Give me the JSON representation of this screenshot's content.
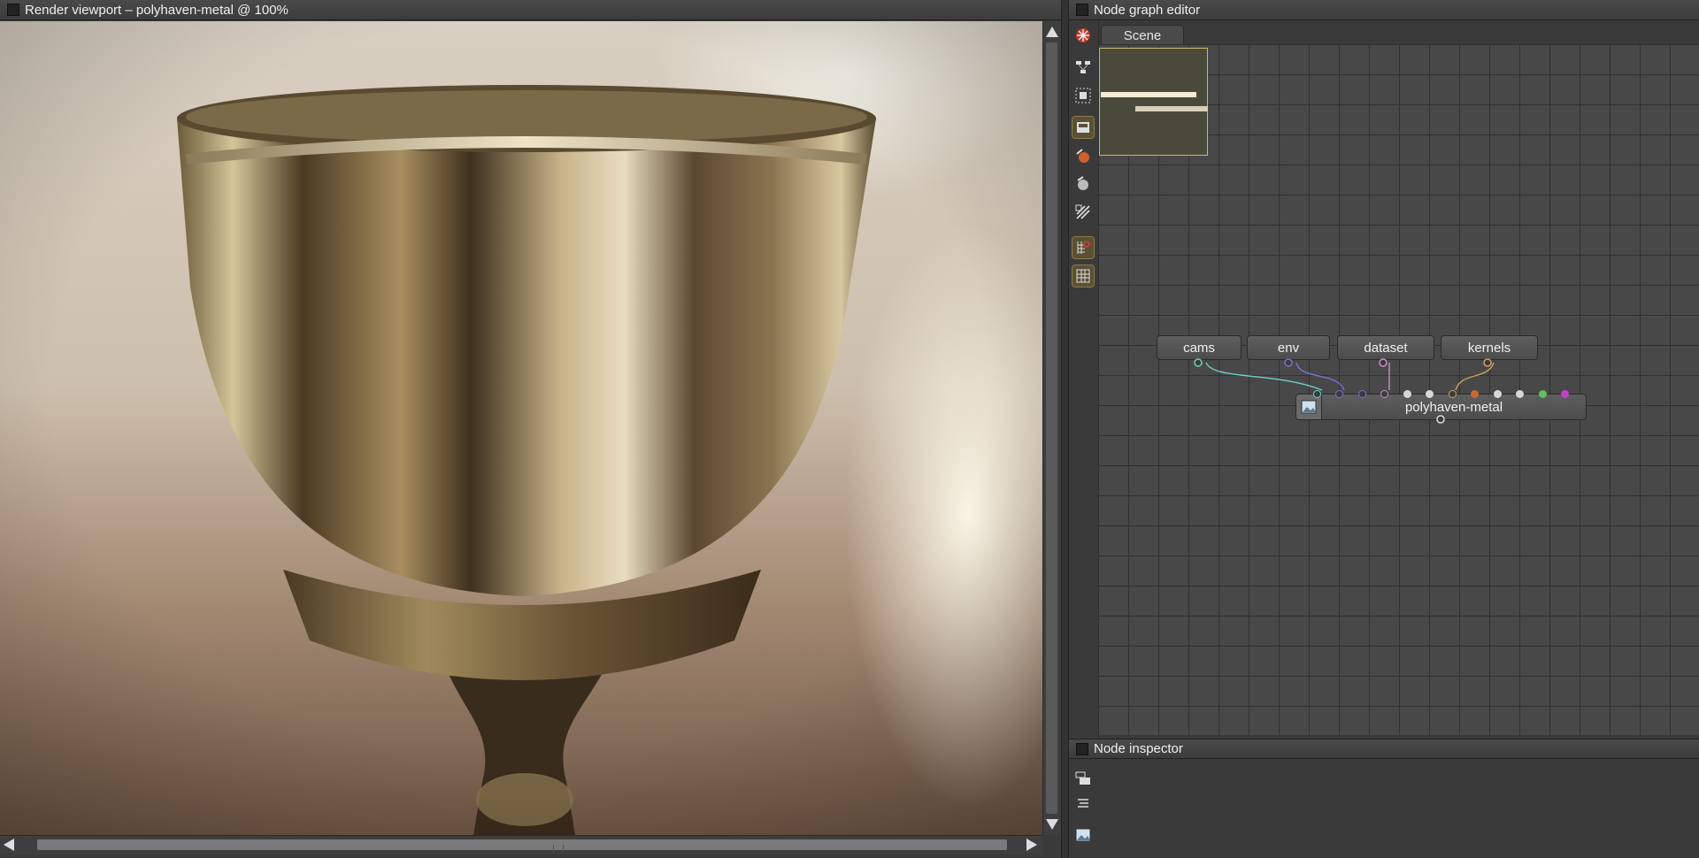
{
  "viewport": {
    "title": "Render viewport – polyhaven-metal @ 100%"
  },
  "node_graph": {
    "title": "Node graph editor",
    "tabs": [
      "Scene"
    ],
    "toolbar": [
      {
        "icon": "render-target-icon",
        "active": false
      },
      {
        "icon": "graph-layout-icon",
        "active": false
      },
      {
        "icon": "graph-select-icon",
        "active": false
      },
      {
        "icon": "scene-icon",
        "active": true
      },
      {
        "icon": "material-icon",
        "active": false
      },
      {
        "icon": "texture-icon",
        "active": false
      },
      {
        "icon": "geometry-icon",
        "active": false
      },
      {
        "icon": "snap-grid-icon",
        "active": true
      },
      {
        "icon": "grid-icon",
        "active": true
      }
    ],
    "nodes": {
      "inputs": [
        "cams",
        "env",
        "dataset",
        "kernels"
      ],
      "main": "polyhaven-metal"
    },
    "pin_colors": [
      "#6fd0c0",
      "#7a70d8",
      "#7a70d8",
      "#c890c0",
      "#d8d8d8",
      "#d8d8d8",
      "#d0a060",
      "#c86a30",
      "#d8d8d8",
      "#d8d8d8",
      "#60c060",
      "#c040c8"
    ]
  },
  "inspector": {
    "title": "Node inspector",
    "toolbar": [
      "expand-all-icon",
      "collapse-icon",
      "image-icon"
    ]
  }
}
